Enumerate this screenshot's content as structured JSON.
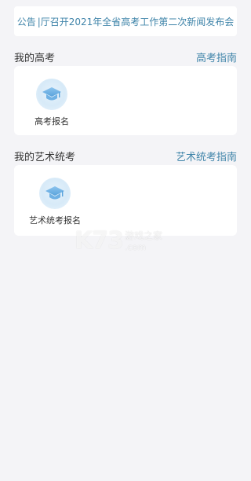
{
  "notice": {
    "label": "公告",
    "text": "|厅召开2021年全省高考工作第二次新闻发布会"
  },
  "gaokao": {
    "title": "我的高考",
    "link": "高考指南",
    "items": [
      {
        "label": "高考报名",
        "icon": "graduation-cap-icon"
      }
    ]
  },
  "art": {
    "title": "我的艺术统考",
    "link": "艺术统考指南",
    "items": [
      {
        "label": "艺术统考报名",
        "icon": "graduation-cap-icon"
      }
    ]
  },
  "watermark": {
    "logo": "K73",
    "line1": "游戏之家",
    "line2": ".com"
  },
  "colors": {
    "accent": "#3f84a9",
    "background": "#f4f4f7",
    "card": "#ffffff"
  }
}
